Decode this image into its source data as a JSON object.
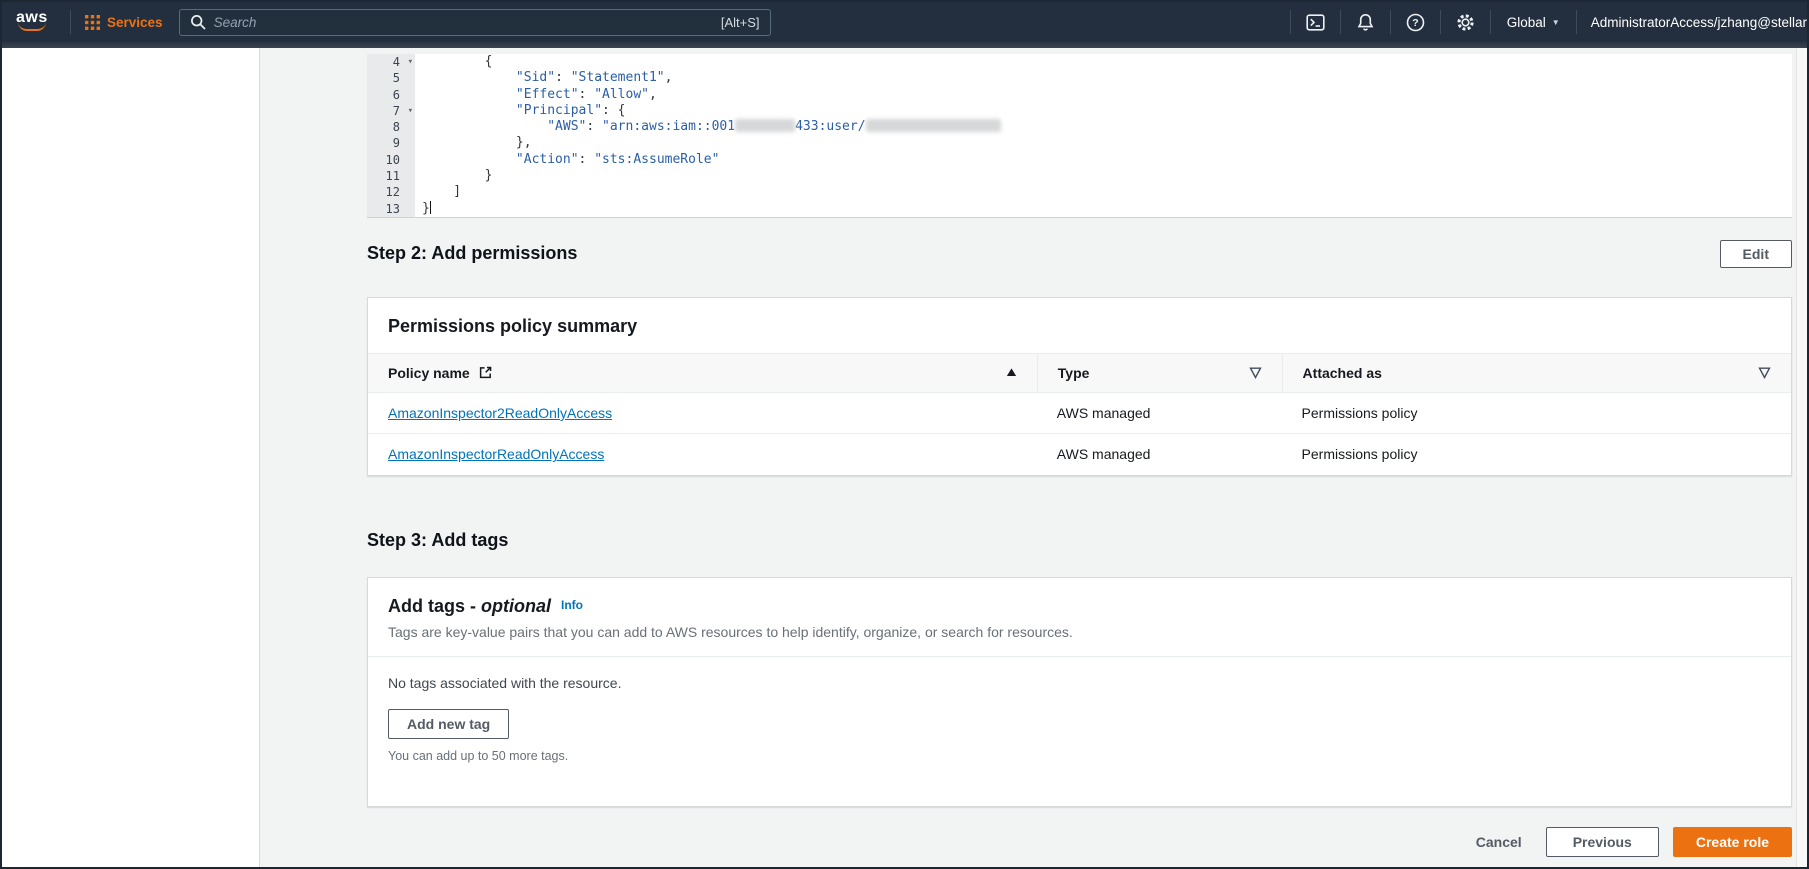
{
  "topnav": {
    "logo_text": "aws",
    "services_label": "Services",
    "search_placeholder": "Search",
    "search_shortcut": "[Alt+S]",
    "region_label": "Global",
    "account_label": "AdministratorAccess/jzhang@stellar",
    "icon_names": [
      "services-grid",
      "search",
      "cloudshell-terminal",
      "notifications-bell",
      "help",
      "settings-gear",
      "caret-down"
    ]
  },
  "glyphs": {
    "fold": "▾",
    "caret_down": "▼"
  },
  "editor": {
    "lines": [
      {
        "n": "4",
        "fold": true,
        "seg": [
          [
            "p",
            "        {"
          ]
        ]
      },
      {
        "n": "5",
        "seg": [
          [
            "p",
            "            "
          ],
          [
            "s",
            "\"Sid\""
          ],
          [
            "p",
            ": "
          ],
          [
            "s",
            "\"Statement1\""
          ],
          [
            "p",
            ","
          ]
        ]
      },
      {
        "n": "6",
        "seg": [
          [
            "p",
            "            "
          ],
          [
            "s",
            "\"Effect\""
          ],
          [
            "p",
            ": "
          ],
          [
            "s",
            "\"Allow\""
          ],
          [
            "p",
            ","
          ]
        ]
      },
      {
        "n": "7",
        "fold": true,
        "seg": [
          [
            "p",
            "            "
          ],
          [
            "s",
            "\"Principal\""
          ],
          [
            "p",
            ": {"
          ]
        ]
      },
      {
        "n": "8",
        "seg": [
          [
            "p",
            "                "
          ],
          [
            "s",
            "\"AWS\""
          ],
          [
            "p",
            ": "
          ],
          [
            "s",
            "\"arn:aws:iam::001"
          ],
          [
            "b",
            60
          ],
          [
            "s",
            "433:user/"
          ],
          [
            "b",
            135
          ]
        ]
      },
      {
        "n": "9",
        "seg": [
          [
            "p",
            "            },"
          ]
        ]
      },
      {
        "n": "10",
        "seg": [
          [
            "p",
            "            "
          ],
          [
            "s",
            "\"Action\""
          ],
          [
            "p",
            ": "
          ],
          [
            "s",
            "\"sts:AssumeRole\""
          ]
        ]
      },
      {
        "n": "11",
        "seg": [
          [
            "p",
            "        }"
          ]
        ]
      },
      {
        "n": "12",
        "seg": [
          [
            "p",
            "    ]"
          ]
        ]
      },
      {
        "n": "13",
        "cursor": true,
        "seg": [
          [
            "p",
            "}"
          ]
        ]
      }
    ]
  },
  "step2": {
    "heading": "Step 2: Add permissions",
    "edit_button_label": "Edit"
  },
  "permissions_card": {
    "title": "Permissions policy summary",
    "table": {
      "columns": [
        {
          "label": "Policy name",
          "has_external_link_icon": true,
          "sort": "ascending"
        },
        {
          "label": "Type",
          "filterable": true
        },
        {
          "label": "Attached as",
          "filterable": true
        }
      ],
      "rows": [
        {
          "policy_name": "AmazonInspector2ReadOnlyAccess",
          "type": "AWS managed",
          "attached_as": "Permissions policy"
        },
        {
          "policy_name": "AmazonInspectorReadOnlyAccess",
          "type": "AWS managed",
          "attached_as": "Permissions policy"
        }
      ]
    }
  },
  "step3": {
    "heading": "Step 3: Add tags",
    "card_title": "Add tags - ",
    "card_title_em": "optional",
    "info_link_label": "Info",
    "description": "Tags are key-value pairs that you can add to AWS resources to help identify, organize, or search for resources.",
    "empty_message": "No tags associated with the resource.",
    "add_tag_button_label": "Add new tag",
    "limit_message": "You can add up to 50 more tags."
  },
  "footer": {
    "cancel_label": "Cancel",
    "previous_label": "Previous",
    "create_label": "Create role"
  },
  "colors": {
    "nav_bg": "#232f3e",
    "accent_orange": "#ec7211",
    "link_blue": "#0073bb",
    "code_string_blue": "#2b5fa5"
  }
}
